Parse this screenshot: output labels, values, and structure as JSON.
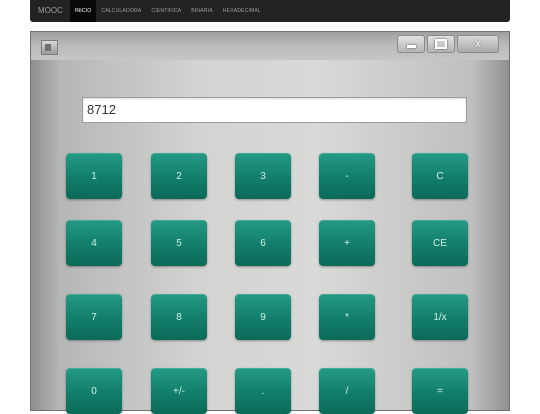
{
  "nav": {
    "brand": "MOOC",
    "items": [
      "INICIO",
      "CALCULADORA",
      "CIENTIFICA",
      "BINARIA",
      "HEXADECIMAL"
    ],
    "active_index": 0
  },
  "window": {
    "controls": {
      "minimize": "minimize-icon",
      "maximize": "maximize-icon",
      "close": "X"
    }
  },
  "display": {
    "value": "8712"
  },
  "keys": {
    "k1": "1",
    "k2": "2",
    "k3": "3",
    "sub": "-",
    "clear": "C",
    "k4": "4",
    "k5": "5",
    "k6": "6",
    "add": "+",
    "clear_entry": "CE",
    "k7": "7",
    "k8": "8",
    "k9": "9",
    "mul": "*",
    "inv": "1/x",
    "k0": "0",
    "neg": "+/-",
    "dot": ".",
    "div": "/",
    "eq": "="
  },
  "colors": {
    "key": "#13806c",
    "navbar": "#222222"
  }
}
